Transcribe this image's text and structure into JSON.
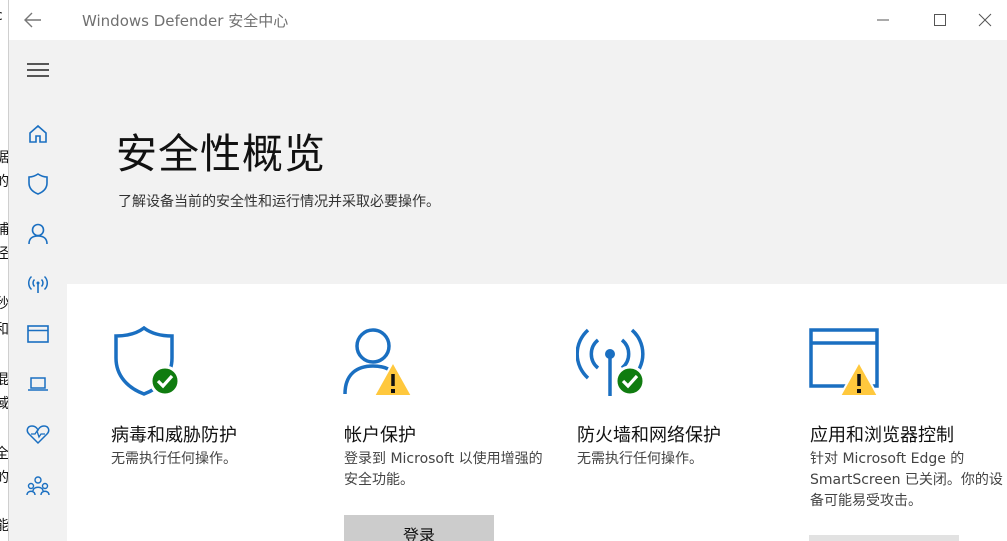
{
  "window": {
    "title": "Windows Defender 安全中心"
  },
  "page": {
    "title": "安全性概览",
    "subtitle": "了解设备当前的安全性和运行情况并采取必要操作。"
  },
  "nav": [
    {
      "icon": "menu-icon"
    },
    {
      "icon": "home-icon"
    },
    {
      "icon": "shield-icon"
    },
    {
      "icon": "person-icon"
    },
    {
      "icon": "wireless-icon"
    },
    {
      "icon": "browser-window-icon"
    },
    {
      "icon": "laptop-icon"
    },
    {
      "icon": "heart-health-icon"
    },
    {
      "icon": "family-icon"
    }
  ],
  "cards": [
    {
      "title": "病毒和威胁防护",
      "desc": "无需执行任何操作。",
      "status": "ok",
      "icon": "shield-icon"
    },
    {
      "title": "帐户保护",
      "desc": "登录到 Microsoft 以使用增强的安全功能。",
      "status": "warning",
      "icon": "person-icon",
      "button": "登录"
    },
    {
      "title": "防火墙和网络保护",
      "desc": "无需执行任何操作。",
      "status": "ok",
      "icon": "wireless-icon"
    },
    {
      "title": "应用和浏览器控制",
      "desc": "针对 Microsoft Edge 的 SmartScreen 已关闭。你的设备可能易受攻击。",
      "status": "warning",
      "icon": "browser-window-icon"
    }
  ],
  "colors": {
    "accent": "#1a6fc1",
    "ok": "#107c10",
    "warning": "#ffc83d"
  }
}
